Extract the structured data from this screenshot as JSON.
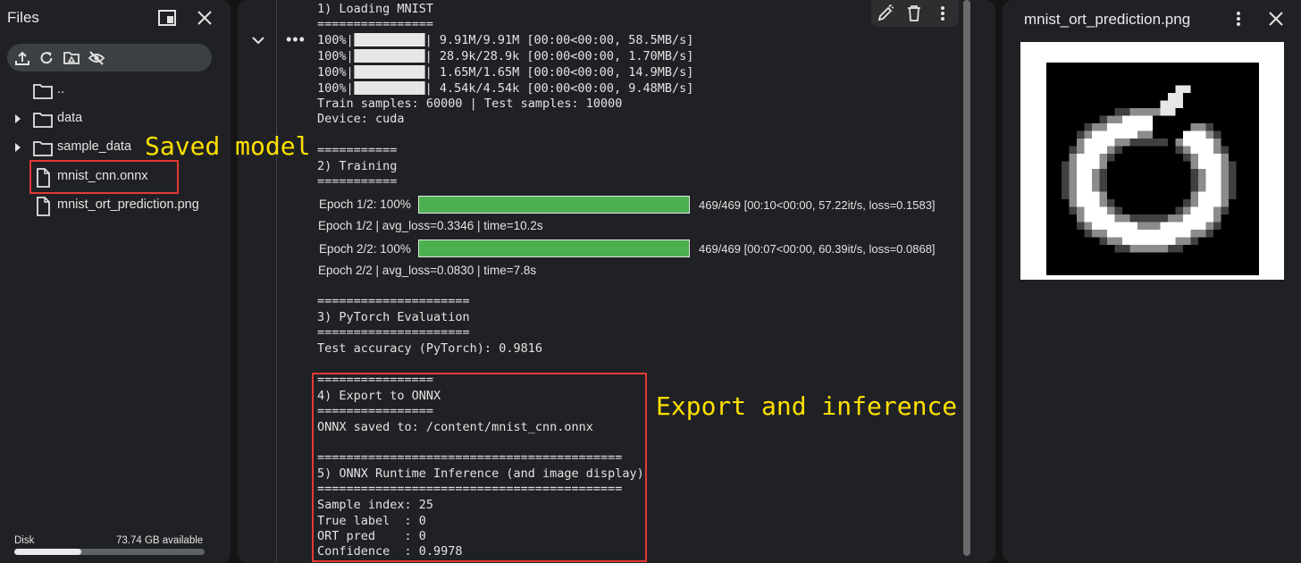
{
  "files_panel": {
    "title": "Files",
    "tree": [
      {
        "label": "..",
        "type": "folder",
        "expandable": false
      },
      {
        "label": "data",
        "type": "folder",
        "expandable": true
      },
      {
        "label": "sample_data",
        "type": "folder",
        "expandable": true
      },
      {
        "label": "mnist_cnn.onnx",
        "type": "file",
        "expandable": false
      },
      {
        "label": "mnist_ort_prediction.png",
        "type": "file",
        "expandable": false
      }
    ],
    "disk": {
      "label": "Disk",
      "available": "73.74 GB available",
      "used_fraction": 0.35
    }
  },
  "annotations": {
    "saved_model": "Saved model",
    "export_inference": "Export and inference"
  },
  "notebook_output": {
    "loading": {
      "header": "1) Loading MNIST",
      "rule": "================",
      "downloads": [
        {
          "prefix": "100%|",
          "suffix": "| 9.91M/9.91M [00:00<00:00, 58.5MB/s]"
        },
        {
          "prefix": "100%|",
          "suffix": "| 28.9k/28.9k [00:00<00:00, 1.70MB/s]"
        },
        {
          "prefix": "100%|",
          "suffix": "| 1.65M/1.65M [00:00<00:00, 14.9MB/s]"
        },
        {
          "prefix": "100%|",
          "suffix": "| 4.54k/4.54k [00:00<00:00, 9.48MB/s]"
        }
      ],
      "samples": "Train samples: 60000 | Test samples: 10000",
      "device": "Device: cuda"
    },
    "training": {
      "rule": "===========",
      "header": "2) Training",
      "epochs": [
        {
          "label": "Epoch 1/2: 100%",
          "progress": 1.0,
          "stats": "469/469  [00:10<00:00,  57.22it/s,  loss=0.1583]",
          "summary": "Epoch 1/2 | avg_loss=0.3346 | time=10.2s"
        },
        {
          "label": "Epoch 2/2: 100%",
          "progress": 1.0,
          "stats": "469/469  [00:07<00:00,  60.39it/s,  loss=0.0868]",
          "summary": "Epoch 2/2 | avg_loss=0.0830 | time=7.8s"
        }
      ]
    },
    "evaluation": {
      "rule": "=====================",
      "header": "3) PyTorch Evaluation",
      "accuracy": "Test accuracy (PyTorch): 0.9816"
    },
    "export": {
      "rule": "================",
      "header": "4) Export to ONNX",
      "saved": "ONNX saved to: /content/mnist_cnn.onnx"
    },
    "inference": {
      "rule": "==========================================",
      "header": "5) ONNX Runtime Inference (and image display)",
      "sample_index": "Sample index: 25",
      "true_label": "True label  : 0",
      "ort_pred": "ORT pred    : 0",
      "confidence": "Confidence  : 0.9978"
    }
  },
  "image_viewer": {
    "title": "mnist_ort_prediction.png"
  },
  "colors": {
    "background": "#141414",
    "panel": "#202124",
    "progress_green": "#4caf50",
    "highlight_red": "#e53935",
    "annotation_yellow": "#ffe000"
  },
  "icons": [
    "open-in-tab-icon",
    "close-icon",
    "upload-icon",
    "refresh-icon",
    "mount-drive-icon",
    "hide-files-icon",
    "folder-icon",
    "file-icon",
    "chevron-right-icon",
    "chevron-down-icon",
    "more-horiz-icon",
    "edit-icon",
    "delete-icon",
    "more-vert-icon"
  ]
}
